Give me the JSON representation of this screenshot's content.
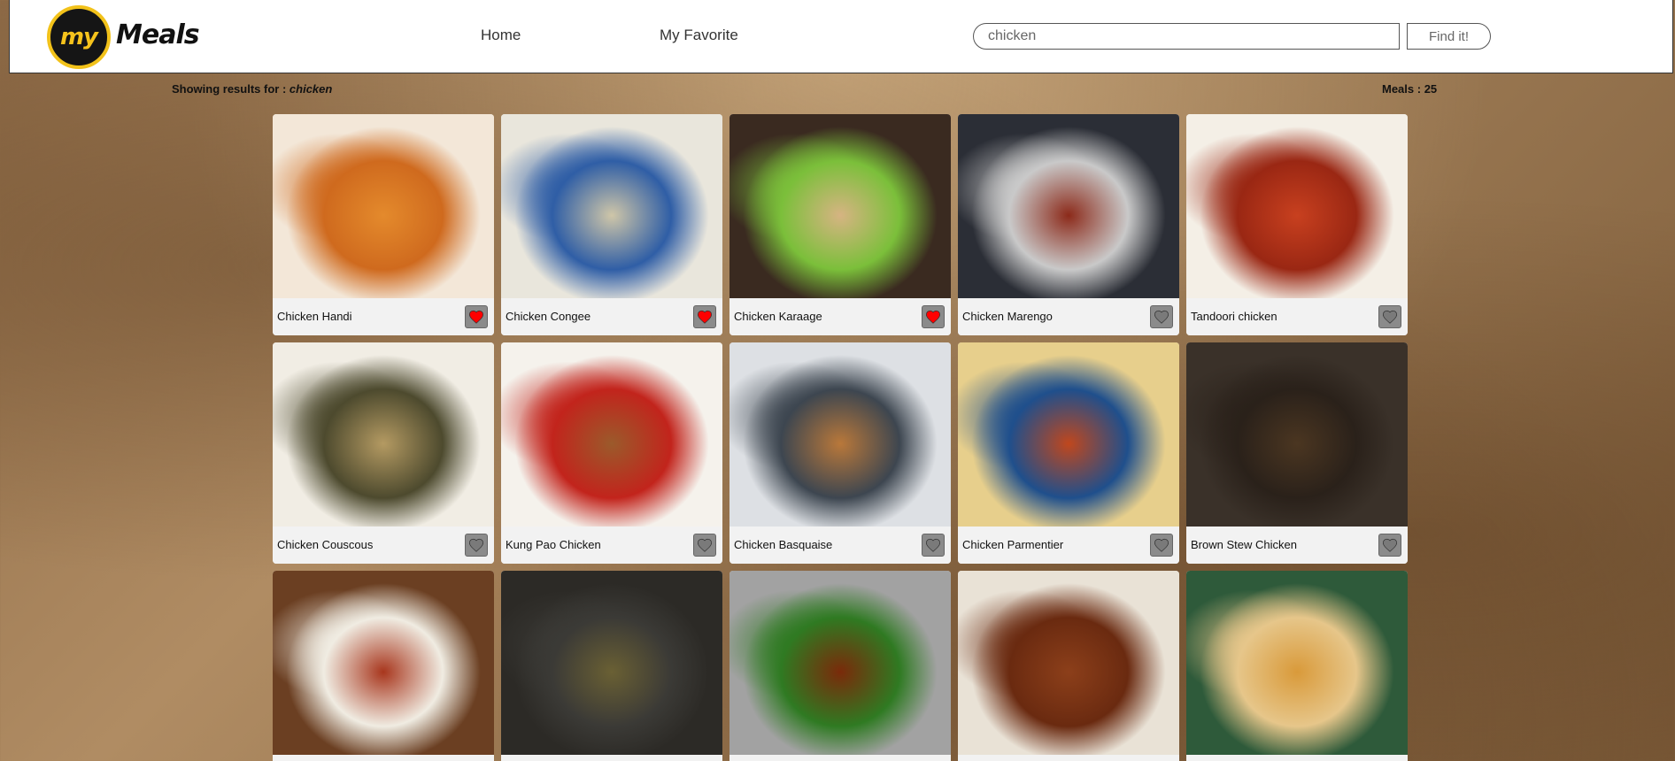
{
  "header": {
    "logo": {
      "prefix": "my",
      "word": "Meals"
    },
    "nav": [
      {
        "label": "Home"
      },
      {
        "label": "My Favorite"
      }
    ],
    "search": {
      "value": "chicken",
      "button_label": "Find it!"
    }
  },
  "results": {
    "prefix": "Showing results for : ",
    "query": "chicken",
    "count_label": "Meals",
    "count": "25"
  },
  "colors": {
    "heart_active": "#ff0000",
    "heart_inactive": "#7a7a7a",
    "logo_yellow": "#f6c31c"
  },
  "meals": [
    {
      "name": "Chicken Handi",
      "favorite": true,
      "photo": [
        "#f3e7d8",
        "#e48a2c",
        "#cf6a1e"
      ]
    },
    {
      "name": "Chicken Congee",
      "favorite": true,
      "photo": [
        "#e9e6dc",
        "#cfc6a8",
        "#2f5ea6"
      ]
    },
    {
      "name": "Chicken Karaage",
      "favorite": true,
      "photo": [
        "#3a2a20",
        "#d6b482",
        "#7bbf3a"
      ]
    },
    {
      "name": "Chicken Marengo",
      "favorite": false,
      "photo": [
        "#2b2e36",
        "#8c2a1a",
        "#c9c9c9"
      ]
    },
    {
      "name": "Tandoori chicken",
      "favorite": false,
      "photo": [
        "#f4efe6",
        "#c8401f",
        "#9a2713"
      ]
    },
    {
      "name": "Chicken Couscous",
      "favorite": false,
      "photo": [
        "#f1ede4",
        "#b49a62",
        "#4d4a2e"
      ]
    },
    {
      "name": "Kung Pao Chicken",
      "favorite": false,
      "photo": [
        "#f5f2ec",
        "#9b5a2b",
        "#c2241c"
      ]
    },
    {
      "name": "Chicken Basquaise",
      "favorite": false,
      "photo": [
        "#dde0e4",
        "#b9783a",
        "#3d4650"
      ]
    },
    {
      "name": "Chicken Parmentier",
      "favorite": false,
      "photo": [
        "#e7cf8c",
        "#c0471d",
        "#1f4f8c"
      ]
    },
    {
      "name": "Brown Stew Chicken",
      "favorite": false,
      "photo": [
        "#3a3129",
        "#4b3621",
        "#2a211a"
      ]
    },
    {
      "name": "",
      "favorite": false,
      "photo": [
        "#6b3f22",
        "#a8361d",
        "#f0ece2"
      ]
    },
    {
      "name": "",
      "favorite": false,
      "photo": [
        "#2c2a26",
        "#6a6034",
        "#3b3a36"
      ]
    },
    {
      "name": "",
      "favorite": false,
      "photo": [
        "#a2a2a2",
        "#7a2a0a",
        "#2f7a22"
      ]
    },
    {
      "name": "",
      "favorite": false,
      "photo": [
        "#e9e2d6",
        "#8c3f1a",
        "#6a2a10"
      ]
    },
    {
      "name": "",
      "favorite": false,
      "photo": [
        "#2e5a3a",
        "#d99a3a",
        "#e6c68a"
      ]
    }
  ]
}
